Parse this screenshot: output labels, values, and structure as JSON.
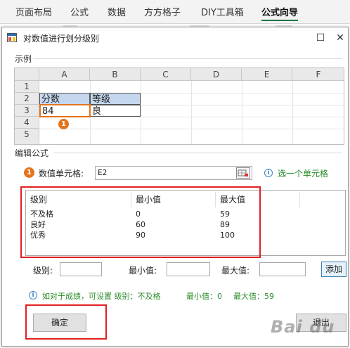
{
  "ribbon": {
    "tabs": [
      "页面布局",
      "公式",
      "数据",
      "方方格子",
      "DIY工具箱",
      "公式向导"
    ],
    "active_index": 5
  },
  "dialog": {
    "title": "对数值进行划分级别",
    "close": "✕",
    "maximize": "☐"
  },
  "example": {
    "section_label": "示例",
    "columns": [
      "A",
      "B",
      "C",
      "D",
      "E",
      "F"
    ],
    "rows": [
      "1",
      "2",
      "3",
      "4",
      "5"
    ],
    "cells": {
      "A2": "分数",
      "B2": "等级",
      "A3": "84",
      "B3": "良"
    },
    "badge": "1"
  },
  "formula": {
    "section_label": "编辑公式",
    "badge": "1",
    "value_cell_label": "数值单元格:",
    "value_cell_value": "E2",
    "hint": "选一个单元格"
  },
  "levels_table": {
    "columns": [
      "级别",
      "最小值",
      "最大值"
    ],
    "rows": [
      [
        "不及格",
        "0",
        "59"
      ],
      [
        "良好",
        "60",
        "89"
      ],
      [
        "优秀",
        "90",
        "100"
      ]
    ]
  },
  "inputs": {
    "level_label": "级别:",
    "min_label": "最小值:",
    "max_label": "最大值:",
    "add_label": "添加"
  },
  "status": {
    "text": "如对于成绩，可设置 级别：不及格",
    "min": "最小值：0",
    "max": "最大值：59"
  },
  "buttons": {
    "ok": "确定",
    "exit": "退出"
  },
  "watermark": "Bai du",
  "colors": {
    "accent_orange": "#e3741c",
    "highlight_red": "#e02020",
    "green_text": "#2a8a2a",
    "header_blue": "#c5d7ee"
  }
}
